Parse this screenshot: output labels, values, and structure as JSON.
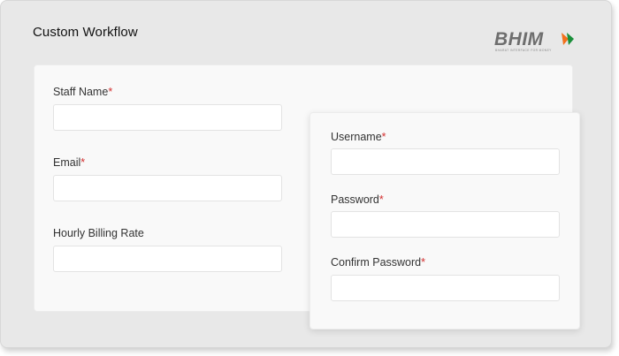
{
  "window": {
    "title": "Custom Workflow",
    "logo": {
      "name": "BHIM",
      "tagline": "BHARAT INTERFACE FOR MONEY"
    }
  },
  "staff_form": {
    "staff_name": {
      "label": "Staff Name",
      "required_mark": "*",
      "value": "",
      "placeholder": ""
    },
    "email": {
      "label": "Email",
      "required_mark": "*",
      "value": "",
      "placeholder": ""
    },
    "hourly_rate": {
      "label": "Hourly Billing Rate",
      "value": "",
      "placeholder": ""
    }
  },
  "account_form": {
    "username": {
      "label": "Username",
      "required_mark": "*",
      "value": "",
      "placeholder": ""
    },
    "password": {
      "label": "Password",
      "required_mark": "*",
      "value": "",
      "placeholder": ""
    },
    "confirm_password": {
      "label": "Confirm Password",
      "required_mark": "*",
      "value": "",
      "placeholder": ""
    }
  },
  "colors": {
    "required": "#d32f2f",
    "logo_orange": "#f2711c",
    "logo_green": "#1a8f3a"
  }
}
